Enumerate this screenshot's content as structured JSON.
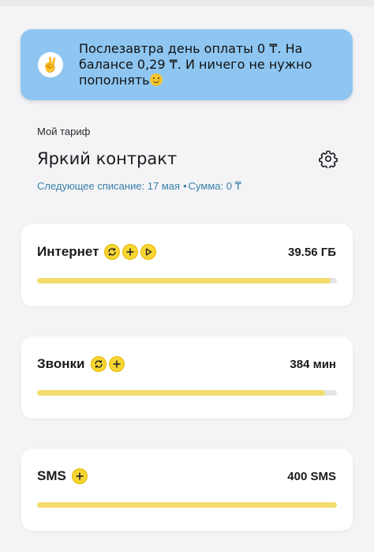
{
  "banner": {
    "icon": "victory-hand-icon",
    "text": "Послезавтра день оплаты 0 ₸. На балансе 0,29 ₸. И ничего не нужно пополнять",
    "emoji": "smiling-face-icon",
    "background": "#8ec6f1"
  },
  "tariff": {
    "caption": "Мой тариф",
    "name": "Яркий контракт",
    "next_charge": "Следующее списание: 17 мая",
    "separator": "•",
    "amount": "Сумма: 0 ₸"
  },
  "packages": [
    {
      "title": "Интернет",
      "value": "39.56 ГБ",
      "remaining_fraction": 0.98,
      "actions": [
        "refresh-icon",
        "plus-icon",
        "play-icon"
      ]
    },
    {
      "title": "Звонки",
      "value": "384 мин",
      "remaining_fraction": 0.96,
      "actions": [
        "refresh-icon",
        "plus-icon"
      ]
    },
    {
      "title": "SMS",
      "value": "400 SMS",
      "remaining_fraction": 1.0,
      "actions": [
        "plus-icon"
      ]
    }
  ],
  "colors": {
    "accent_yellow": "#f5d532",
    "bar_fill": "#f4dc6c",
    "link_blue": "#3a7fa8"
  }
}
